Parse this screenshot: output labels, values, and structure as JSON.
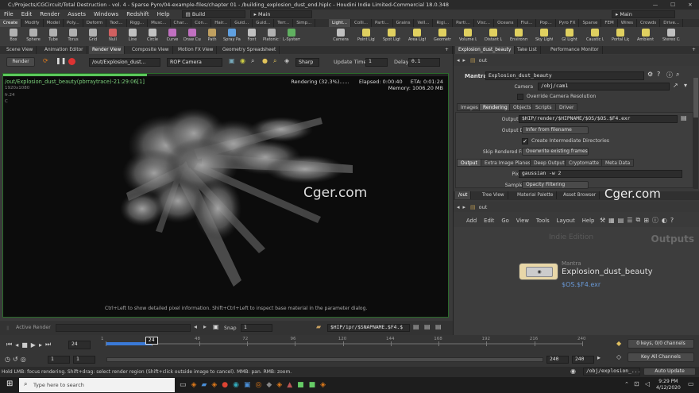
{
  "window": {
    "title": "C:/Projects/CGCircuit/Total Destruction - vol. 4 - Sparse Pyro/04-example-files/chapter 01 - /building_explosion_dust_end.hiplc - Houdini Indie Limited-Commercial 18.0.348",
    "minimize": "—",
    "maximize": "☐",
    "close": "✕"
  },
  "menubar": {
    "items": [
      "File",
      "Edit",
      "Render",
      "Assets",
      "Windows",
      "Redshift",
      "Help"
    ],
    "desktop": "Build",
    "context": "Main",
    "right_context": "Main"
  },
  "shelf": {
    "tabs_left": [
      "Create",
      "Modify",
      "Model",
      "Poly...",
      "Deform",
      "Text...",
      "Rigg...",
      "Musc...",
      "Char...",
      "Con...",
      "Hair...",
      "Guid...",
      "Guid...",
      "Terr...",
      "Simp..."
    ],
    "tabs_right": [
      "Light...",
      "Colli...",
      "Parti...",
      "Grains",
      "Vell...",
      "Rigi...",
      "Parti...",
      "Visc...",
      "Oceans",
      "Flui...",
      "Pop...",
      "Pyro FX",
      "Sparse",
      "FEM",
      "Wires",
      "Crowds",
      "Drive..."
    ],
    "tools_left": [
      {
        "label": "Box",
        "color": "#b0b0b0"
      },
      {
        "label": "Sphere",
        "color": "#b0b0b0"
      },
      {
        "label": "Tube",
        "color": "#b0b0b0"
      },
      {
        "label": "Torus",
        "color": "#b0b0b0"
      },
      {
        "label": "Grid",
        "color": "#b0b0b0"
      },
      {
        "label": "Null",
        "color": "#d06060"
      },
      {
        "label": "Line",
        "color": "#c0c0c0"
      },
      {
        "label": "Circle",
        "color": "#c0c0c0"
      },
      {
        "label": "Curve",
        "color": "#c070c0"
      },
      {
        "label": "Draw Curve",
        "color": "#c070c0"
      },
      {
        "label": "Path",
        "color": "#c0a060"
      },
      {
        "label": "Spray Paint",
        "color": "#60a0e0"
      },
      {
        "label": "Font",
        "color": "#c0c0c0"
      },
      {
        "label": "Platonic Solids",
        "color": "#b0b0b0"
      },
      {
        "label": "L-System",
        "color": "#60b060"
      }
    ],
    "tools_right": [
      {
        "label": "Camera",
        "color": "#c0c0c0"
      },
      {
        "label": "Point Light",
        "color": "#e0d060"
      },
      {
        "label": "Spot Light",
        "color": "#e0d060"
      },
      {
        "label": "Area Light",
        "color": "#e0d060"
      },
      {
        "label": "Geometry Light",
        "color": "#e0d060"
      },
      {
        "label": "Volume Light",
        "color": "#e0d060"
      },
      {
        "label": "Distant Light",
        "color": "#e0d060"
      },
      {
        "label": "Environment Light",
        "color": "#e0d060"
      },
      {
        "label": "Sky Light",
        "color": "#e0d060"
      },
      {
        "label": "GI Light",
        "color": "#e0d060"
      },
      {
        "label": "Caustic Light",
        "color": "#e0d060"
      },
      {
        "label": "Portal Light",
        "color": "#e0d060"
      },
      {
        "label": "Ambient Light",
        "color": "#e0d060"
      },
      {
        "label": "Stereo Camera",
        "color": "#c0c0c0"
      }
    ]
  },
  "left_pane": {
    "tabs": [
      "Scene View",
      "Animation Editor",
      "Render View",
      "Composite View",
      "Motion FX View",
      "Geometry Spreadsheet"
    ],
    "render_button": "Render",
    "rop_path": "/out/Explosion_dust...",
    "camera": "ROP Camera",
    "sharp": "Sharp",
    "update_time_label": "Update Time",
    "update_time_value": "1",
    "delay_label": "Delay",
    "delay_value": "0.1",
    "viewport": {
      "job": "/out/Explosion_dust_beauty(pbrraytrace)-21:29:06[1]",
      "resolution": "1920x1080",
      "frame": "fr.24",
      "channel": "C",
      "rendering": "Rendering (32.3%)......",
      "elapsed": "Elapsed: 0:00:40",
      "eta": "ETA: 0:01:24",
      "memory": "Memory: 1006.20 MB",
      "watermark": "Cger.com",
      "hint": "Ctrl+Left to show detailed pixel information. Shift+Ctrl+Left to inspect base material in the parameter dialog.",
      "progress": 32.3
    },
    "bottom": {
      "active_render": "Active Render",
      "snap_label": "Snap",
      "snap_value": "1",
      "snap_path": "$HIP/ipr/$SNAPNAME.$F4.$"
    }
  },
  "right_pane": {
    "tabs_top": [
      "Explosion_dust_beauty",
      "Take List",
      "Performance Monitor"
    ],
    "path": "out",
    "node_type": "Mantra",
    "node_name": "Explosion_dust_beauty",
    "camera_label": "Camera",
    "camera_value": "/obj/cam1",
    "override_res": "Override Camera Resolution",
    "param_tabs": [
      "Images",
      "Rendering",
      "Objects",
      "Scripts",
      "Driver"
    ],
    "output_picture_label": "Output Picture",
    "output_picture_value": "$HIP/render/$HIPNAME/$OS/$OS.$F4.exr",
    "output_device_label": "Output Device",
    "output_device_value": "Infer from filename",
    "create_dirs": "Create Intermediate Directories",
    "skip_label": "Skip Rendered Frames",
    "skip_value": "Overwrite existing frames",
    "sub_tabs": [
      "Output",
      "Extra Image Planes",
      "Deep Output",
      "Cryptomatte",
      "Meta Data"
    ],
    "pixel_filter_label": "Pixel Filter",
    "pixel_filter_value": "gaussian -w 2",
    "sample_filter_label": "Sample Filter",
    "sample_filter_value": "Opacity Filtering",
    "net_tabs": [
      "/out",
      "Tree View",
      "Material Palette",
      "Asset Browser"
    ],
    "net_watermark": "Cger.com",
    "net_path": "out",
    "net_menu": [
      "Add",
      "Edit",
      "Go",
      "View",
      "Tools",
      "Layout",
      "Help"
    ],
    "edition": "Indie Edition",
    "context_label": "Outputs",
    "node": {
      "type": "Mantra",
      "name": "Explosion_dust_beauty",
      "sub": "$OS.$F4.exr"
    }
  },
  "timeline": {
    "frame": "24",
    "start": "1",
    "start2": "1",
    "end": "240",
    "end2": "240",
    "ticks": [
      "1",
      "24",
      "48",
      "72",
      "96",
      "120",
      "144",
      "168",
      "192",
      "216",
      "240"
    ],
    "current_tick": "24",
    "keys": "0 keys, 0/0 channels",
    "key_all": "Key All Channels",
    "cur_frame": 24,
    "frame_count": 240
  },
  "status": {
    "text": "Hold LMB: focus rendering. Shift+drag: select render region (Shift+click outside image to cancel). MMB: pan. RMB: zoom.",
    "path": "/obj/explosion_...",
    "update": "Auto Update"
  },
  "taskbar": {
    "search": "Type here to search",
    "time": "9:29 PM",
    "date": "4/12/2020"
  },
  "colors": {
    "accent_orange": "#e07a1a",
    "render_green": "#5ac85a",
    "timeline_blue": "#3a7ad8"
  }
}
